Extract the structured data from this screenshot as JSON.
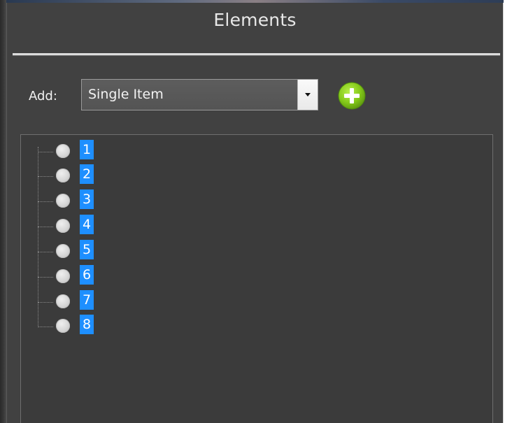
{
  "panel": {
    "title": "Elements"
  },
  "add": {
    "label": "Add:",
    "dropdown_value": "Single Item",
    "button_icon": "plus-circle-icon"
  },
  "tree": {
    "items": [
      {
        "label": "1",
        "icon": "circle-node-icon"
      },
      {
        "label": "2",
        "icon": "circle-node-icon"
      },
      {
        "label": "3",
        "icon": "circle-node-icon"
      },
      {
        "label": "4",
        "icon": "circle-node-icon"
      },
      {
        "label": "5",
        "icon": "circle-node-icon"
      },
      {
        "label": "6",
        "icon": "circle-node-icon"
      },
      {
        "label": "7",
        "icon": "circle-node-icon"
      },
      {
        "label": "8",
        "icon": "circle-node-icon"
      }
    ]
  },
  "colors": {
    "background": "#414141",
    "selection": "#1e8fff",
    "add_button": "#83c819"
  }
}
